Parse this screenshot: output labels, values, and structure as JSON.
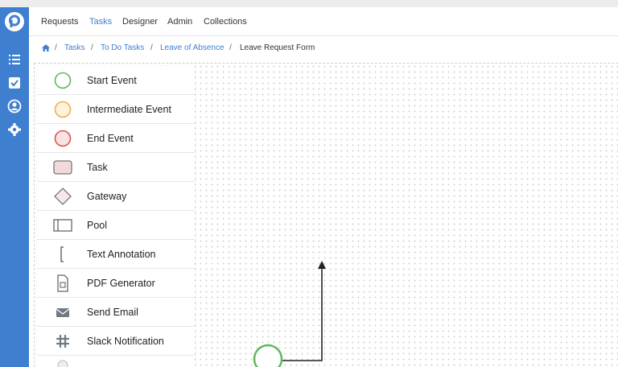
{
  "app": {
    "brand_color": "#3f7fd0"
  },
  "sidebar": {
    "icons": [
      "logo-icon",
      "list-icon",
      "checkbox-icon",
      "user-circle-icon",
      "gear-icon"
    ]
  },
  "topnav": {
    "items": [
      {
        "label": "Requests"
      },
      {
        "label": "Tasks",
        "active": true
      },
      {
        "label": "Designer"
      },
      {
        "label": "Admin"
      },
      {
        "label": "Collections"
      }
    ]
  },
  "breadcrumb": {
    "items": [
      "Tasks",
      "To Do Tasks",
      "Leave of Absence",
      "Leave Request Form"
    ],
    "separator": "/"
  },
  "palette": {
    "items": [
      {
        "label": "Start Event",
        "icon": "start-event-icon"
      },
      {
        "label": "Intermediate Event",
        "icon": "intermediate-event-icon"
      },
      {
        "label": "End Event",
        "icon": "end-event-icon"
      },
      {
        "label": "Task",
        "icon": "task-icon"
      },
      {
        "label": "Gateway",
        "icon": "gateway-icon"
      },
      {
        "label": "Pool",
        "icon": "pool-icon"
      },
      {
        "label": "Text Annotation",
        "icon": "text-annotation-icon"
      },
      {
        "label": "PDF Generator",
        "icon": "pdf-generator-icon"
      },
      {
        "label": "Send Email",
        "icon": "send-email-icon"
      },
      {
        "label": "Slack Notification",
        "icon": "slack-notification-icon"
      }
    ]
  },
  "colors": {
    "start": "#5cb85c",
    "intermediate": "#f0ad4e",
    "end": "#d9534f"
  }
}
